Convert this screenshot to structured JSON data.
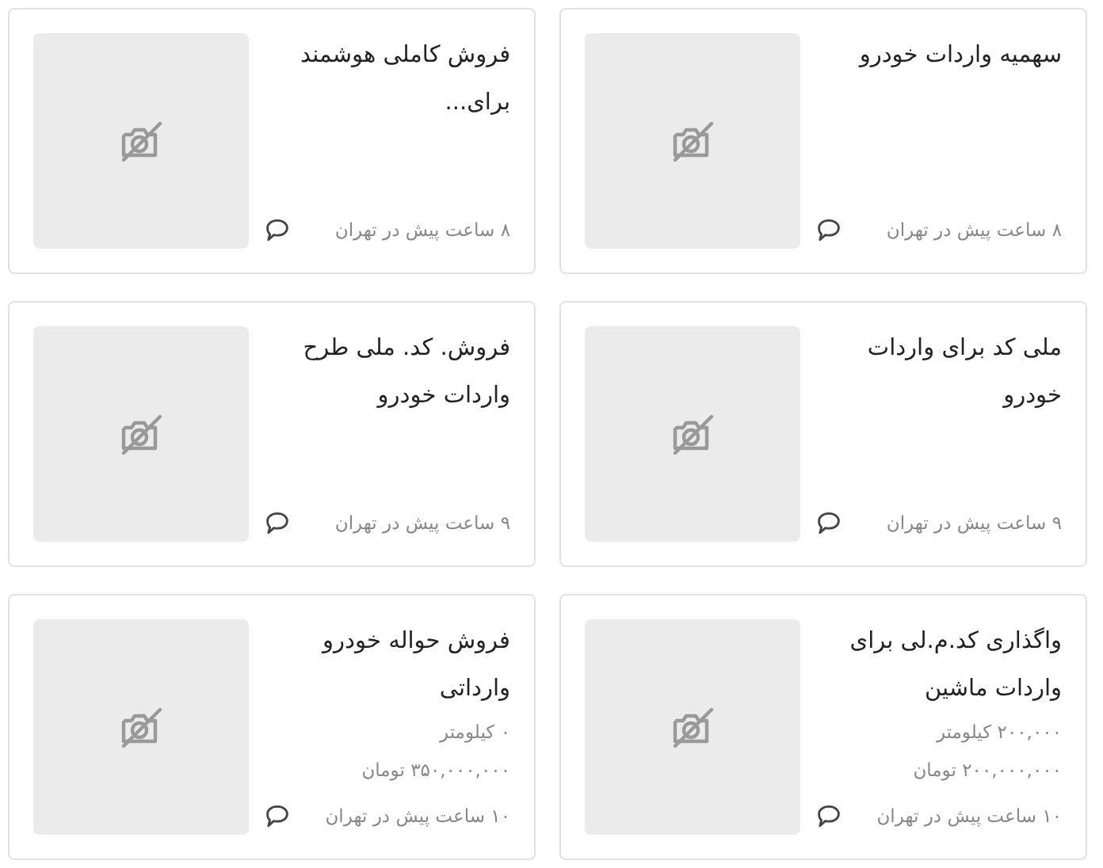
{
  "cards": [
    {
      "title": "سهمیه واردات خودرو",
      "posted": "۸ ساعت پیش در تهران"
    },
    {
      "title": "فروش کاملی هوشمند برای...",
      "posted": "۸ ساعت پیش در تهران"
    },
    {
      "title": "ملی کد برای واردات خودرو",
      "posted": "۹ ساعت پیش در تهران"
    },
    {
      "title": "فروش. کد. ملی طرح واردات خودرو",
      "posted": "۹ ساعت پیش در تهران"
    },
    {
      "title": "واگذاری کد.م.لی برای واردات ماشین",
      "mileage": "۲۰۰,۰۰۰ کیلومتر",
      "price": "۲۰۰,۰۰۰,۰۰۰ تومان",
      "posted": "۱۰ ساعت پیش در تهران"
    },
    {
      "title": "فروش حواله خودرو وارداتی",
      "mileage": "۰ کیلومتر",
      "price": "۳۵۰,۰۰۰,۰۰۰ تومان",
      "posted": "۱۰ ساعت پیش در تهران"
    }
  ]
}
